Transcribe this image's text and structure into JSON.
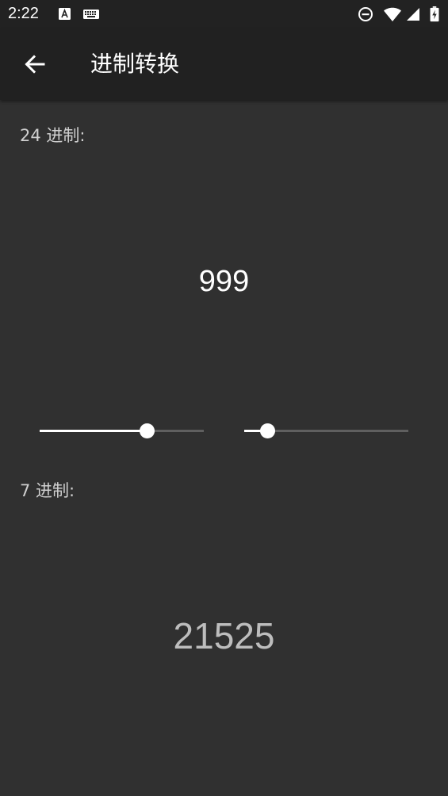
{
  "status_bar": {
    "time": "2:22",
    "icons": [
      "text-a-notification-icon",
      "keyboard-icon",
      "do-not-disturb-icon",
      "wifi-icon",
      "cell-signal-icon",
      "battery-charging-icon"
    ]
  },
  "app_bar": {
    "title": "进制转换",
    "back_icon": "arrow-back-icon"
  },
  "source": {
    "label": "24 进制:",
    "value": "999",
    "radix": 24
  },
  "target": {
    "label": "7 进制:",
    "value": "21525",
    "radix": 7
  },
  "sliders": {
    "source_radix_fraction": 0.65,
    "target_radix_fraction": 0.14
  },
  "colors": {
    "background": "#303030",
    "app_bar": "#212121",
    "status_bar": "#222222",
    "accent": "#ffffff"
  }
}
